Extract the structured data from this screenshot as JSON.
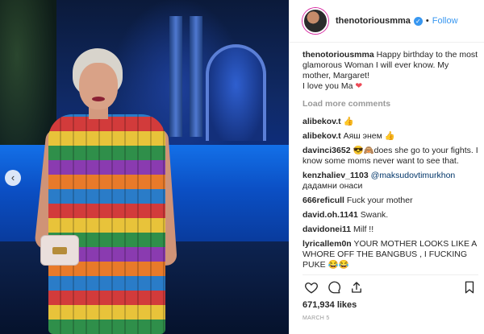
{
  "post": {
    "username": "thenotoriousmma",
    "follow_label": "Follow",
    "dot": "•",
    "caption": {
      "user": "thenotoriousmma",
      "text": "Happy birthday to the most glamorous Woman I will ever know. My mother, Margaret!",
      "line2": "I love you Ma",
      "emoji": "❤"
    },
    "load_more": "Load more comments",
    "comments": [
      {
        "user": "alibekov.t",
        "text": "👍"
      },
      {
        "user": "alibekov.t",
        "text": "Аяш энем 👍"
      },
      {
        "user": "davinci3652",
        "text": "😎🙈does she go to your fights. I know some moms never want to see that."
      },
      {
        "user": "kenzhaliev_1103",
        "mention": "@maksudovtimurkhon",
        "text": "дадамни онаси"
      },
      {
        "user": "666reficull",
        "text": "Fuck your mother"
      },
      {
        "user": "david.oh.1141",
        "text": "Swank."
      },
      {
        "user": "davidonei11",
        "text": "Milf !!"
      },
      {
        "user": "lyricallem0n",
        "text": "YOUR MOTHER LOOKS LIKE A WHORE OFF THE BANGBUS , I FUCKING PUKE 😂😂"
      }
    ],
    "likes": "671,934 likes",
    "date": "MARCH 5"
  },
  "nav": {
    "prev": "‹"
  },
  "colors": {
    "accent": "#3897f0",
    "heart": "#ed4956"
  },
  "icons": [
    "heart-icon",
    "comment-icon",
    "share-icon",
    "bookmark-icon",
    "verified-icon"
  ]
}
